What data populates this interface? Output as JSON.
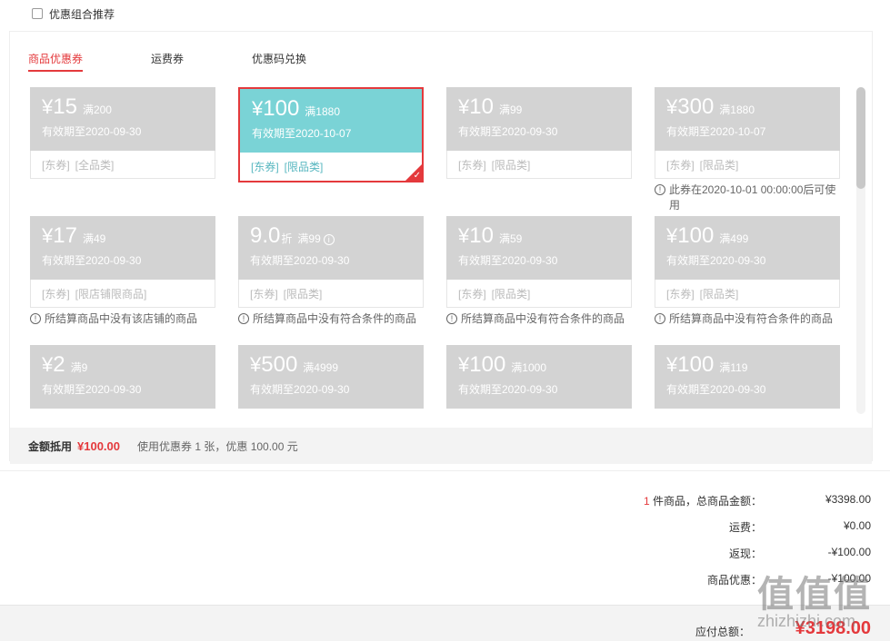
{
  "combo_recommend": {
    "label": "优惠组合推荐",
    "checked": false
  },
  "tabs": [
    {
      "label": "商品优惠券",
      "active": true
    },
    {
      "label": "运费券",
      "active": false
    },
    {
      "label": "优惠码兑换",
      "active": false
    }
  ],
  "coupons": [
    {
      "sym": "¥",
      "value": "15",
      "unit": "",
      "limit": "满200",
      "validity": "有效期至2020-09-30",
      "tag1": "[东券]",
      "tag2": "[全品类]",
      "note": ""
    },
    {
      "sym": "¥",
      "value": "100",
      "unit": "",
      "limit": "满1880",
      "validity": "有效期至2020-10-07",
      "tag1": "[东券]",
      "tag2": "[限品类]",
      "note": "",
      "selected": true
    },
    {
      "sym": "¥",
      "value": "10",
      "unit": "",
      "limit": "满99",
      "validity": "有效期至2020-09-30",
      "tag1": "[东券]",
      "tag2": "[限品类]",
      "note": ""
    },
    {
      "sym": "¥",
      "value": "300",
      "unit": "",
      "limit": "满1880",
      "validity": "有效期至2020-10-07",
      "tag1": "[东券]",
      "tag2": "[限品类]",
      "note": "此券在2020-10-01 00:00:00后可使用"
    },
    {
      "sym": "¥",
      "value": "17",
      "unit": "",
      "limit": "满49",
      "validity": "有效期至2020-09-30",
      "tag1": "[东券]",
      "tag2": "[限店铺限商品]",
      "note": "所结算商品中没有该店铺的商品"
    },
    {
      "sym": "",
      "value": "9.0",
      "unit": "折",
      "limit": "满99",
      "validity": "有效期至2020-09-30",
      "tag1": "[东券]",
      "tag2": "[限品类]",
      "note": "所结算商品中没有符合条件的商品"
    },
    {
      "sym": "¥",
      "value": "10",
      "unit": "",
      "limit": "满59",
      "validity": "有效期至2020-09-30",
      "tag1": "[东券]",
      "tag2": "[限品类]",
      "note": "所结算商品中没有符合条件的商品"
    },
    {
      "sym": "¥",
      "value": "100",
      "unit": "",
      "limit": "满499",
      "validity": "有效期至2020-09-30",
      "tag1": "[东券]",
      "tag2": "[限品类]",
      "note": "所结算商品中没有符合条件的商品"
    },
    {
      "sym": "¥",
      "value": "2",
      "unit": "",
      "limit": "满9",
      "validity": "有效期至2020-09-30",
      "tag1": "",
      "tag2": "",
      "note": ""
    },
    {
      "sym": "¥",
      "value": "500",
      "unit": "",
      "limit": "满4999",
      "validity": "有效期至2020-09-30",
      "tag1": "",
      "tag2": "",
      "note": ""
    },
    {
      "sym": "¥",
      "value": "100",
      "unit": "",
      "limit": "满1000",
      "validity": "有效期至2020-09-30",
      "tag1": "",
      "tag2": "",
      "note": ""
    },
    {
      "sym": "¥",
      "value": "100",
      "unit": "",
      "limit": "满119",
      "validity": "有效期至2020-09-30",
      "tag1": "",
      "tag2": "",
      "note": ""
    }
  ],
  "summary": {
    "label": "金额抵用",
    "amount": "¥100.00",
    "desc": "使用优惠券 1 张，优惠 100.00 元"
  },
  "totals": {
    "count": "1",
    "items_label": " 件商品，总商品金额：",
    "items_value": "¥3398.00",
    "shipping_label": "运费：",
    "shipping_value": "¥0.00",
    "cashback_label": "返现：",
    "cashback_value": "-¥100.00",
    "discount_label": "商品优惠：",
    "discount_value": "-¥100.00"
  },
  "payable": {
    "label": "应付总额：",
    "amount": "¥3198.00"
  },
  "watermark": {
    "big": "值值值",
    "small": "zhizhizhi.com"
  },
  "colors": {
    "accent": "#e4393c",
    "selected_coupon": "#7ad3d6",
    "disabled_coupon": "#d3d3d3"
  }
}
